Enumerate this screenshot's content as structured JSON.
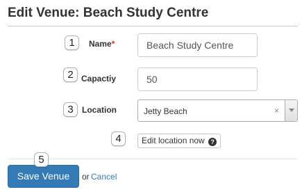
{
  "page": {
    "title": "Edit Venue: Beach Study Centre"
  },
  "form": {
    "name": {
      "step": "1",
      "label": "Name",
      "required_marker": "*",
      "value": "Beach Study Centre"
    },
    "capacity": {
      "step": "2",
      "label": "Capactiy",
      "value": "50"
    },
    "location": {
      "step": "3",
      "label": "Location",
      "value": "Jetty Beach",
      "clear_glyph": "×"
    },
    "edit_location": {
      "step": "4",
      "label": "Edit location now",
      "help_glyph": "?"
    }
  },
  "actions": {
    "step": "5",
    "save_label": "Save Venue",
    "or_text": "or",
    "cancel_label": "Cancel"
  },
  "colors": {
    "primary": "#337ab7",
    "required": "#c9302c",
    "text": "#333333"
  }
}
